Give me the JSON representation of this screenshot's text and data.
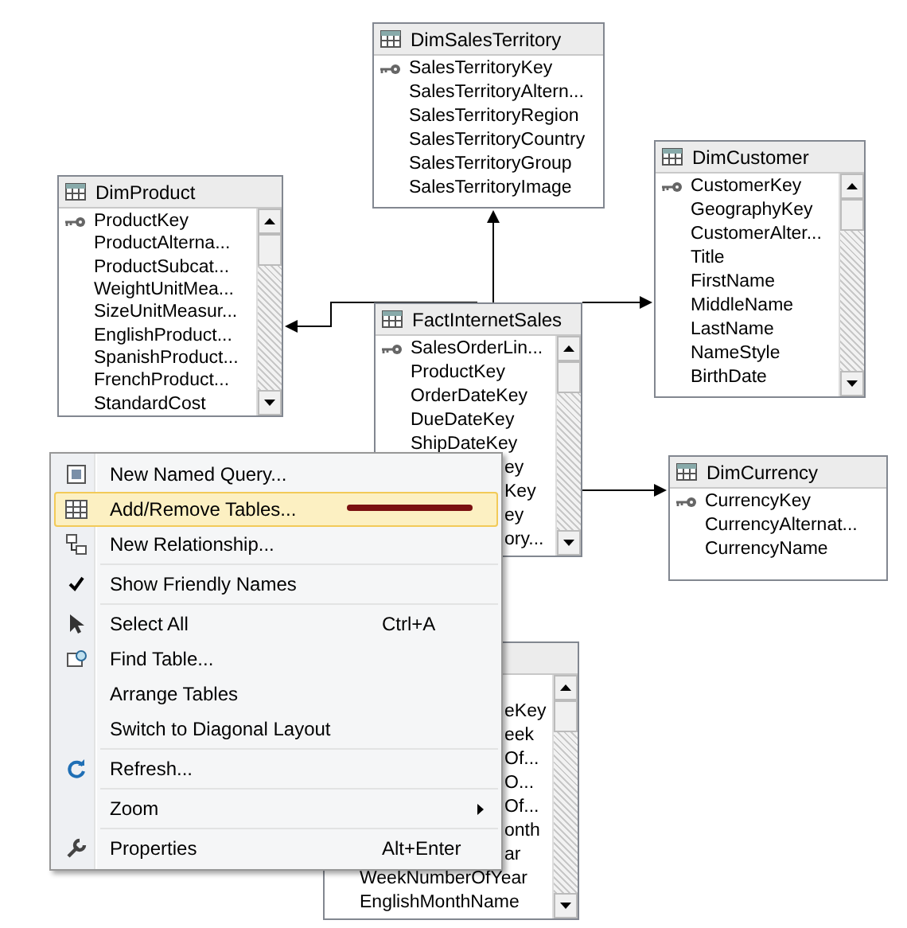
{
  "tables": [
    {
      "name": "DimSalesTerritory",
      "scroll": false,
      "rows": [
        {
          "text": "SalesTerritoryKey",
          "key": true
        },
        {
          "text": "SalesTerritoryAltern...",
          "key": false
        },
        {
          "text": "SalesTerritoryRegion",
          "key": false
        },
        {
          "text": "SalesTerritoryCountry",
          "key": false
        },
        {
          "text": "SalesTerritoryGroup",
          "key": false
        },
        {
          "text": "SalesTerritoryImage",
          "key": false
        }
      ]
    },
    {
      "name": "DimProduct",
      "scroll": true,
      "rows": [
        {
          "text": "ProductKey",
          "key": true
        },
        {
          "text": "ProductAlterna...",
          "key": false
        },
        {
          "text": "ProductSubcat...",
          "key": false
        },
        {
          "text": "WeightUnitMea...",
          "key": false
        },
        {
          "text": "SizeUnitMeasur...",
          "key": false
        },
        {
          "text": "EnglishProduct...",
          "key": false
        },
        {
          "text": "SpanishProduct...",
          "key": false
        },
        {
          "text": "FrenchProduct...",
          "key": false
        },
        {
          "text": "StandardCost",
          "key": false
        }
      ]
    },
    {
      "name": "DimCustomer",
      "scroll": true,
      "rows": [
        {
          "text": "CustomerKey",
          "key": true
        },
        {
          "text": "GeographyKey",
          "key": false
        },
        {
          "text": "CustomerAlter...",
          "key": false
        },
        {
          "text": "Title",
          "key": false
        },
        {
          "text": "FirstName",
          "key": false
        },
        {
          "text": "MiddleName",
          "key": false
        },
        {
          "text": "LastName",
          "key": false
        },
        {
          "text": "NameStyle",
          "key": false
        },
        {
          "text": "BirthDate",
          "key": false
        }
      ]
    },
    {
      "name": "FactInternetSales",
      "scroll": true,
      "rows": [
        {
          "text": "SalesOrderLin...",
          "key": true
        },
        {
          "text": "ProductKey",
          "key": false
        },
        {
          "text": "OrderDateKey",
          "key": false
        },
        {
          "text": "DueDateKey",
          "key": false
        },
        {
          "text": "ShipDateKey",
          "key": false
        },
        {
          "text": "ey",
          "key": false,
          "covered": true
        },
        {
          "text": "Key",
          "key": false,
          "covered": true
        },
        {
          "text": "ey",
          "key": false,
          "covered": true
        },
        {
          "text": "ory...",
          "key": false,
          "covered": true
        }
      ]
    },
    {
      "name": "DimCurrency",
      "scroll": false,
      "rows": [
        {
          "text": "CurrencyKey",
          "key": true
        },
        {
          "text": "CurrencyAlternat...",
          "key": false
        },
        {
          "text": "CurrencyName",
          "key": false
        }
      ]
    },
    {
      "scroll": true,
      "rows": [
        {
          "text": "eKey",
          "key": false,
          "covered": true
        },
        {
          "text": "eek",
          "key": false,
          "covered": true
        },
        {
          "text": "Of...",
          "key": false,
          "covered": true
        },
        {
          "text": "O...",
          "key": false,
          "covered": true
        },
        {
          "text": "Of...",
          "key": false,
          "covered": true
        },
        {
          "text": "onth",
          "key": false,
          "covered": true
        },
        {
          "text": "ar",
          "key": false,
          "covered": true
        },
        {
          "text": "WeekNumberOfYear",
          "key": false
        },
        {
          "text": "EnglishMonthName",
          "key": false
        }
      ]
    }
  ],
  "context_menu": {
    "items": [
      {
        "kind": "item",
        "label": "New Named Query...",
        "selected": false
      },
      {
        "kind": "item",
        "label": "Add/Remove Tables...",
        "selected": true
      },
      {
        "kind": "item",
        "label": "New Relationship...",
        "selected": false
      },
      {
        "kind": "separator"
      },
      {
        "kind": "item",
        "label": "Show Friendly Names",
        "selected": false,
        "checked": true
      },
      {
        "kind": "separator"
      },
      {
        "kind": "item",
        "label": "Select All",
        "shortcut": "Ctrl+A",
        "selected": false
      },
      {
        "kind": "item",
        "label": "Find Table...",
        "selected": false
      },
      {
        "kind": "item",
        "label": "Arrange Tables",
        "selected": false
      },
      {
        "kind": "item",
        "label": "Switch to Diagonal Layout",
        "selected": false
      },
      {
        "kind": "separator"
      },
      {
        "kind": "item",
        "label": "Refresh...",
        "selected": false
      },
      {
        "kind": "separator"
      },
      {
        "kind": "item",
        "label": "Zoom",
        "selected": false,
        "submenu": true
      },
      {
        "kind": "separator"
      },
      {
        "kind": "item",
        "label": "Properties",
        "shortcut": "Alt+Enter",
        "selected": false
      }
    ]
  }
}
